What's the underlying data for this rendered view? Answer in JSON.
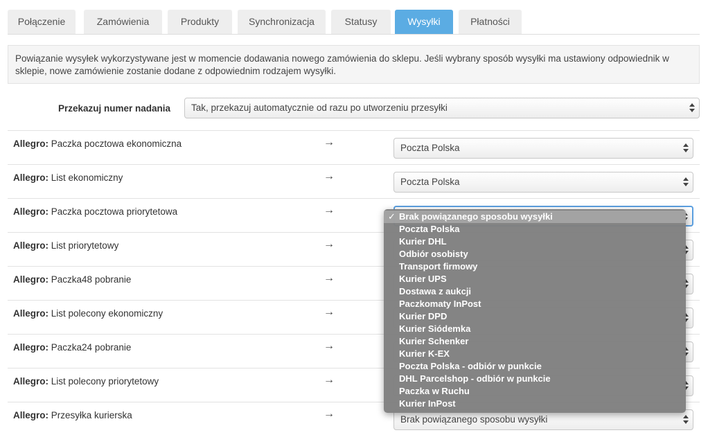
{
  "tabs": [
    {
      "label": "Połączenie",
      "active": false
    },
    {
      "label": "Zamówienia",
      "active": false
    },
    {
      "label": "Produkty",
      "active": false
    },
    {
      "label": "Synchronizacja",
      "active": false
    },
    {
      "label": "Statusy",
      "active": false
    },
    {
      "label": "Wysyłki",
      "active": true
    },
    {
      "label": "Płatności",
      "active": false
    }
  ],
  "info_text": "Powiązanie wysyłek wykorzystywane jest w momencie dodawania nowego zamówienia do sklepu. Jeśli wybrany sposób wysyłki ma ustawiony odpowiednik w sklepie, nowe zamówienie zostanie dodane z odpowiednim rodzajem wysyłki.",
  "tracking": {
    "label": "Przekazuj numer nadania",
    "value": "Tak, przekazuj automatycznie od razu po utworzeniu przesyłki"
  },
  "arrow_glyph": "→",
  "rows": [
    {
      "prefix": "Allegro:",
      "method": "Paczka pocztowa ekonomiczna",
      "value": "Poczta Polska"
    },
    {
      "prefix": "Allegro:",
      "method": "List ekonomiczny",
      "value": "Poczta Polska"
    },
    {
      "prefix": "Allegro:",
      "method": "Paczka pocztowa priorytetowa",
      "value": "Brak powiązanego sposobu wysyłki"
    },
    {
      "prefix": "Allegro:",
      "method": "List priorytetowy",
      "value": ""
    },
    {
      "prefix": "Allegro:",
      "method": "Paczka48 pobranie",
      "value": ""
    },
    {
      "prefix": "Allegro:",
      "method": "List polecony ekonomiczny",
      "value": ""
    },
    {
      "prefix": "Allegro:",
      "method": "Paczka24 pobranie",
      "value": ""
    },
    {
      "prefix": "Allegro:",
      "method": "List polecony priorytetowy",
      "value": ""
    },
    {
      "prefix": "Allegro:",
      "method": "Przesyłka kurierska",
      "value": "Brak powiązanego sposobu wysyłki"
    }
  ],
  "dropdown": {
    "check_glyph": "✓",
    "selected_index": 0,
    "options": [
      "Brak powiązanego sposobu wysyłki",
      "Poczta Polska",
      "Kurier DHL",
      "Odbiór osobisty",
      "Transport firmowy",
      "Kurier UPS",
      "Dostawa z aukcji",
      "Paczkomaty InPost",
      "Kurier DPD",
      "Kurier Siódemka",
      "Kurier Schenker",
      "Kurier K-EX",
      "Poczta Polska - odbiór w punkcie",
      "DHL Parcelshop - odbiór w punkcie",
      "Paczka w Ruchu",
      "Kurier InPost"
    ]
  }
}
